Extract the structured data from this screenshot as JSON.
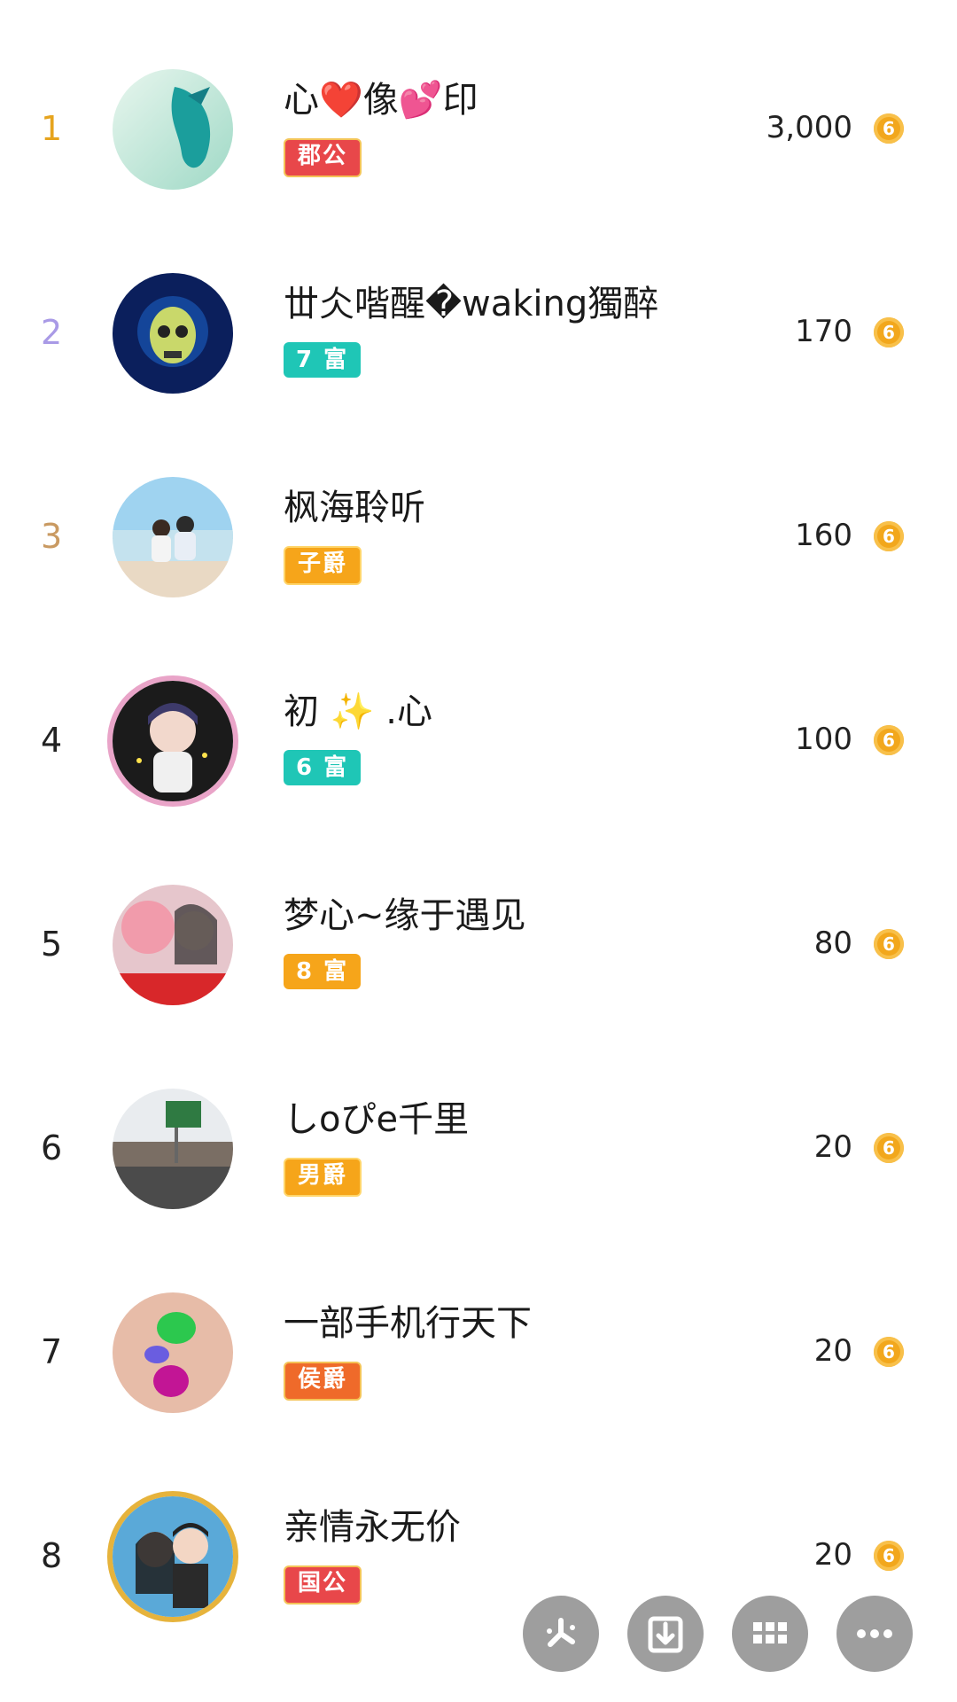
{
  "rows": [
    {
      "rank": "1",
      "name": "心❤️像💕印",
      "badge": "郡公",
      "score": "3,000",
      "coin": "6"
    },
    {
      "rank": "2",
      "name": "丗仌喈醒�waking獨醉",
      "badge": "7 富",
      "score": "170",
      "coin": "6"
    },
    {
      "rank": "3",
      "name": "枫海聆听",
      "badge": "子爵",
      "score": "160",
      "coin": "6"
    },
    {
      "rank": "4",
      "name": "初 ✨ .心",
      "badge": "6 富",
      "score": "100",
      "coin": "6"
    },
    {
      "rank": "5",
      "name": "梦心~缘于遇见",
      "badge": "8 富",
      "score": "80",
      "coin": "6"
    },
    {
      "rank": "6",
      "name": "しoぴe千里",
      "badge": "男爵",
      "score": "20",
      "coin": "6"
    },
    {
      "rank": "7",
      "name": "一部手机行天下",
      "badge": "侯爵",
      "score": "20",
      "coin": "6"
    },
    {
      "rank": "8",
      "name": "亲情永无价",
      "badge": "国公",
      "score": "20",
      "coin": "6"
    }
  ],
  "fabs": [
    {
      "icon": "pinwheel-icon"
    },
    {
      "icon": "download-icon"
    },
    {
      "icon": "grid-icon"
    },
    {
      "icon": "more-icon"
    }
  ]
}
